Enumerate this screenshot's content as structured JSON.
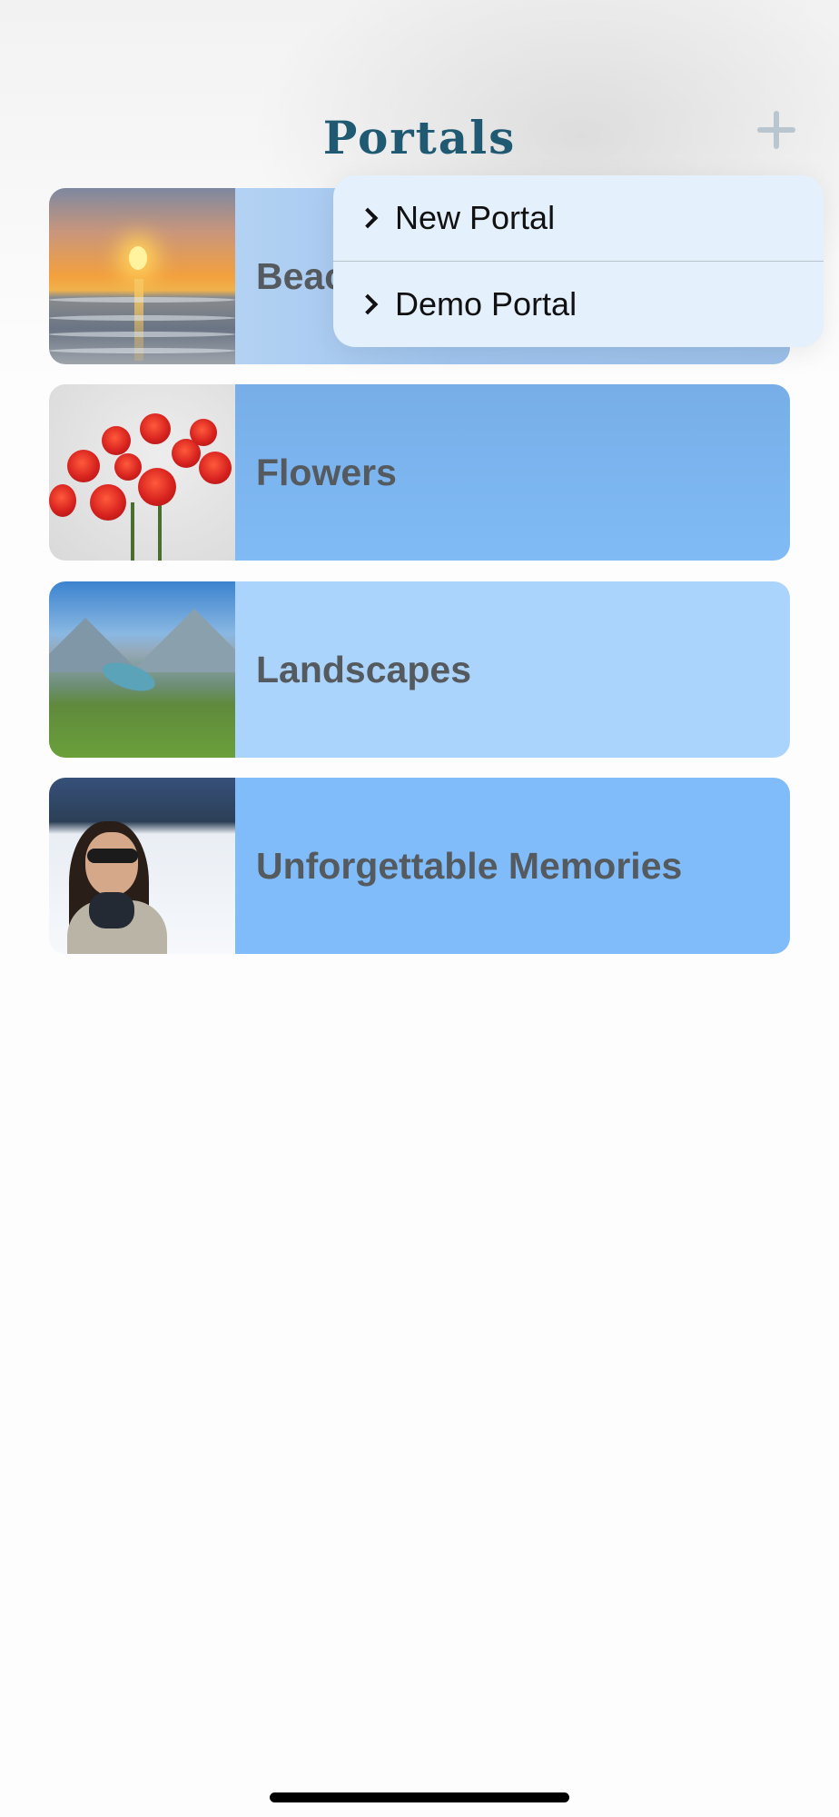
{
  "header": {
    "title": "Portals",
    "add_icon": "plus-icon"
  },
  "portals": [
    {
      "label": "Beaches",
      "thumbnail": "sunset-over-sea"
    },
    {
      "label": "Flowers",
      "thumbnail": "red-roses-bouquet"
    },
    {
      "label": "Landscapes",
      "thumbnail": "mountain-lake-valley"
    },
    {
      "label": "Unforgettable Memories",
      "thumbnail": "woman-in-snow-selfie"
    }
  ],
  "menu": {
    "items": [
      {
        "label": "New Portal",
        "icon": "chevron-right-icon"
      },
      {
        "label": "Demo Portal",
        "icon": "chevron-right-icon"
      }
    ]
  },
  "colors": {
    "title": "#1f5a72",
    "card_blue": "#80bcf9",
    "card_light_blue": "#abd4fc",
    "menu_bg": "#e4f0fc",
    "label_text": "#555a5f"
  }
}
